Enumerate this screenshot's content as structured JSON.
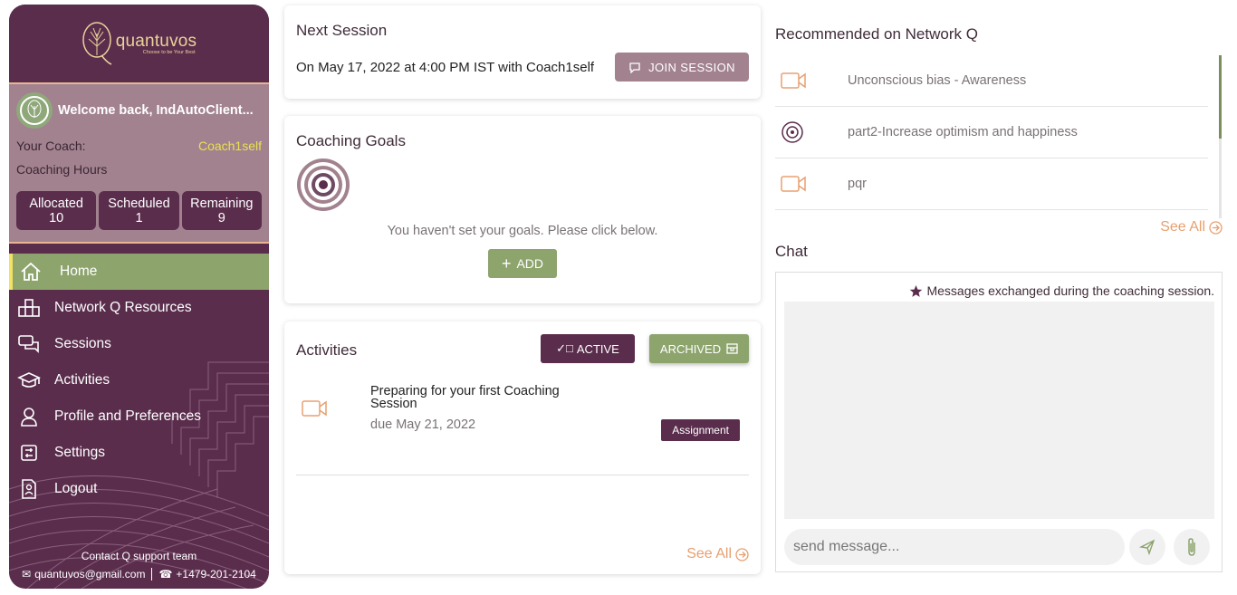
{
  "brand": {
    "name": "quantuvos",
    "tagline": "Choose to be Your Best",
    "accent": "#5a2d4c",
    "green": "#8da46d",
    "mauve": "#a2828f",
    "orange": "#e7a070"
  },
  "profile": {
    "welcome": "Welcome back, IndAutoClient...",
    "coach_label": "Your Coach:",
    "coach_name": "Coach1self",
    "hours_label": "Coaching Hours",
    "hours": [
      {
        "label": "Allocated",
        "value": "10"
      },
      {
        "label": "Scheduled",
        "value": "1"
      },
      {
        "label": "Remaining",
        "value": "9"
      }
    ]
  },
  "nav": {
    "items": [
      {
        "label": "Home",
        "icon": "home-icon",
        "active": true
      },
      {
        "label": "Network Q Resources",
        "icon": "network-icon"
      },
      {
        "label": "Sessions",
        "icon": "chat-bubbles-icon"
      },
      {
        "label": "Activities",
        "icon": "graduation-cap-icon"
      },
      {
        "label": "Profile and Preferences",
        "icon": "user-icon"
      },
      {
        "label": "Settings",
        "icon": "settings-icon"
      },
      {
        "label": "Logout",
        "icon": "logout-icon"
      }
    ]
  },
  "support": {
    "title": "Contact Q support team",
    "email": "quantuvos@gmail.com",
    "phone": "+1479-201-2104"
  },
  "next_session": {
    "title": "Next Session",
    "text": "On May 17, 2022 at 4:00 PM IST with Coach1self",
    "join_label": "JOIN SESSION"
  },
  "goals": {
    "title": "Coaching Goals",
    "message": "You haven't set your goals. Please click below.",
    "add_label": "ADD"
  },
  "activities": {
    "title": "Activities",
    "active_label": "ACTIVE",
    "archived_label": "ARCHIVED",
    "items": [
      {
        "title": "Preparing for your first Coaching Session",
        "due": "due May 21, 2022",
        "badge": "Assignment",
        "icon": "video-icon"
      }
    ],
    "see_all": "See All"
  },
  "recommended": {
    "title": "Recommended on Network Q",
    "items": [
      {
        "label": "Unconscious bias - Awareness",
        "icon": "video-icon"
      },
      {
        "label": "part2-Increase optimism and happiness",
        "icon": "audio-disc-icon"
      },
      {
        "label": "pqr",
        "icon": "video-icon"
      }
    ],
    "see_all": "See All"
  },
  "chat": {
    "title": "Chat",
    "note": "Messages exchanged during the coaching session.",
    "placeholder": "send message..."
  }
}
